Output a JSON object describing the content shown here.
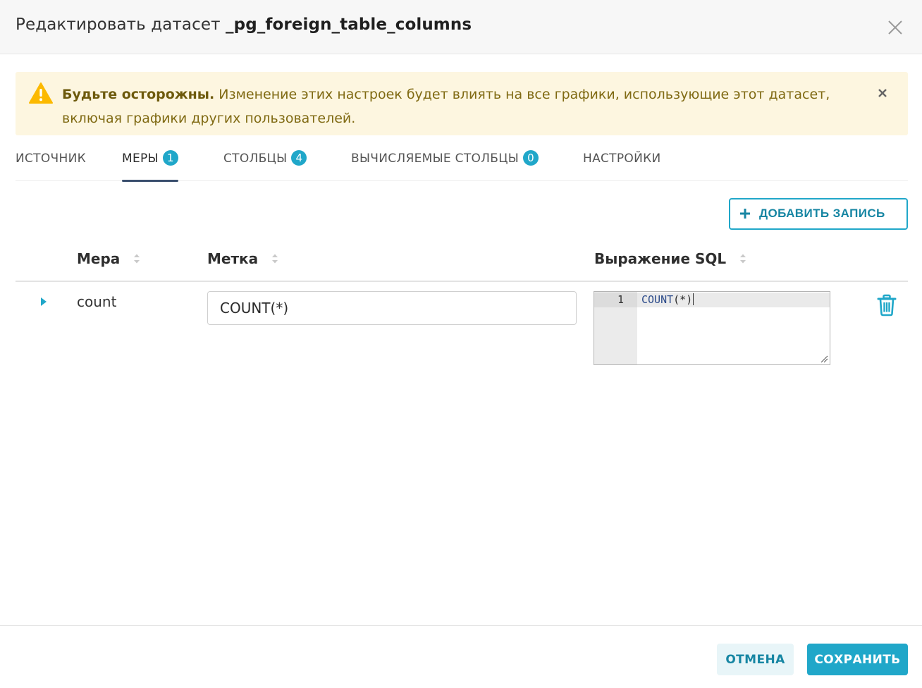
{
  "modal": {
    "title_prefix": "Редактировать датасет",
    "dataset_name": "_pg_foreign_table_columns",
    "close_icon": "close-icon"
  },
  "alert": {
    "icon": "warning-icon",
    "strong": "Будьте осторожны.",
    "message": "Изменение этих настроек будет влиять на все графики, использующие этот датасет, включая графики других пользователей.",
    "close_icon": "close-icon"
  },
  "tabs": [
    {
      "label": "ИСТОЧНИК",
      "badge": null
    },
    {
      "label": "МЕРЫ",
      "badge": "1",
      "active": true
    },
    {
      "label": "СТОЛБЦЫ",
      "badge": "4"
    },
    {
      "label": "ВЫЧИСЛЯЕМЫЕ СТОЛБЦЫ",
      "badge": "0"
    },
    {
      "label": "НАСТРОЙКИ",
      "badge": null
    }
  ],
  "toolbar": {
    "add_label": "ДОБАВИТЬ ЗАПИСЬ",
    "add_icon": "plus-icon"
  },
  "table": {
    "columns": [
      "Мера",
      "Метка",
      "Выражение SQL"
    ],
    "rows": [
      {
        "metric_name": "count",
        "label": "COUNT(*)",
        "sql_line_number": "1",
        "sql_fn": "COUNT",
        "sql_rest": "(*)",
        "delete_icon": "trash-icon"
      }
    ]
  },
  "footer": {
    "cancel_label": "ОТМЕНА",
    "save_label": "СОХРАНИТЬ"
  },
  "colors": {
    "primary": "#20a7c9",
    "alert_bg": "#fdf6e0",
    "alert_text": "#806a13",
    "warning": "#fcb900",
    "tab_underline": "#3a4f6e"
  }
}
